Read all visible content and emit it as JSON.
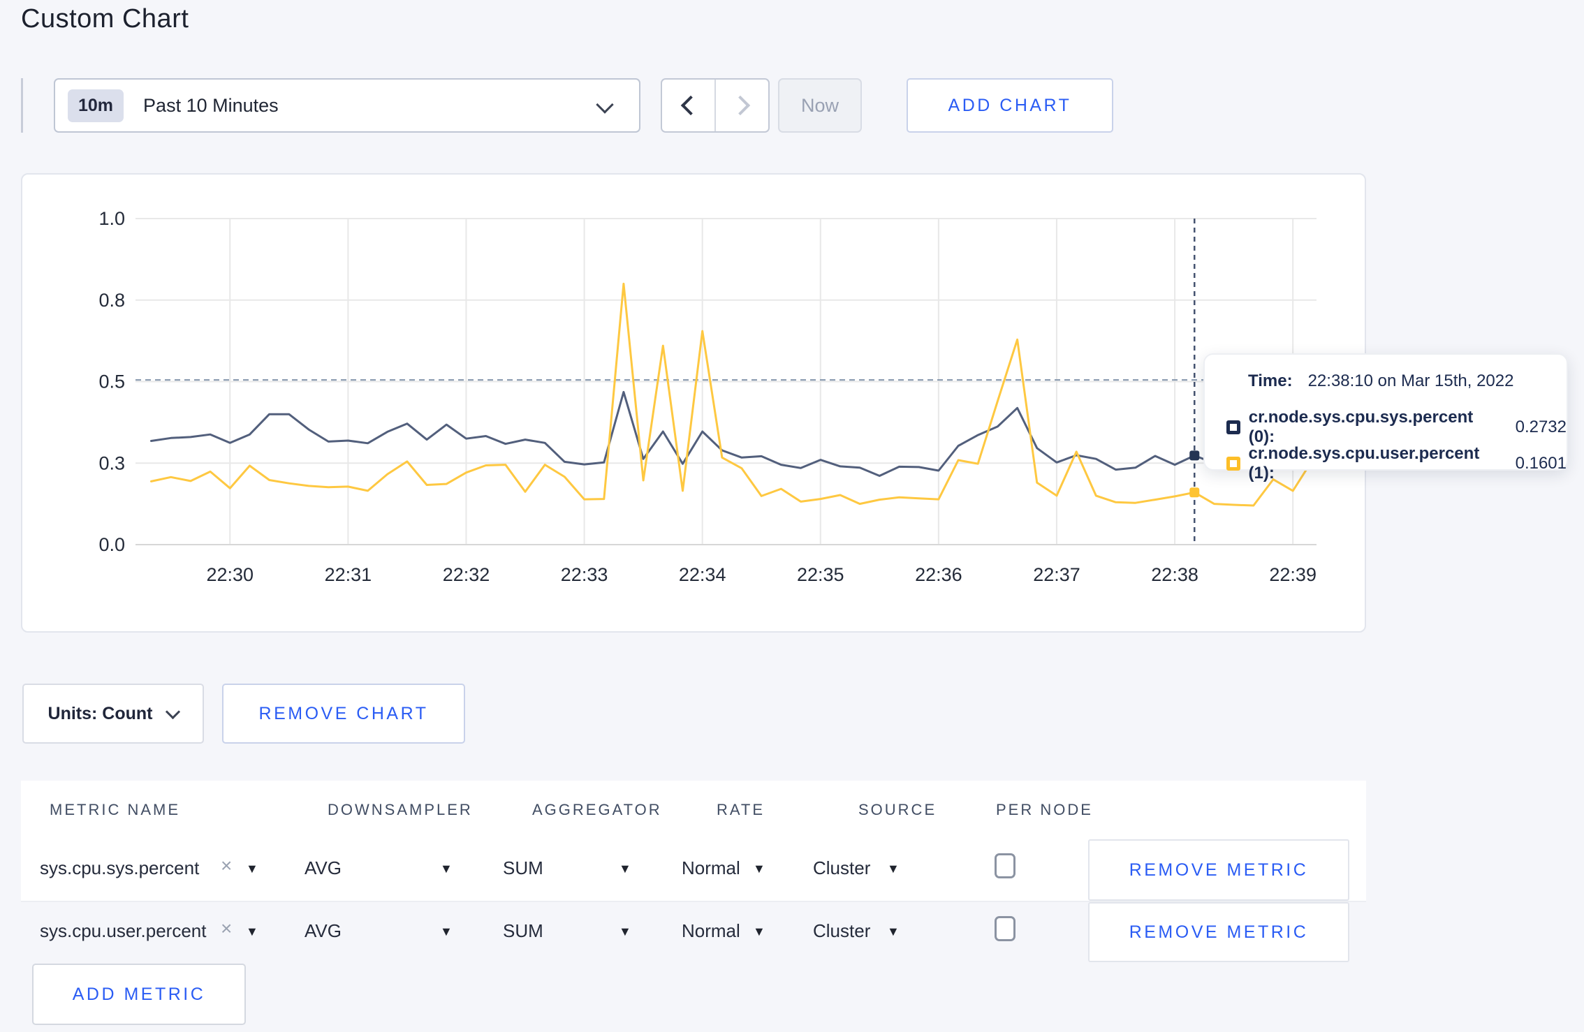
{
  "page": {
    "title": "Custom Chart"
  },
  "toolbar": {
    "time_range": {
      "badge": "10m",
      "label": "Past 10 Minutes"
    },
    "now_label": "Now",
    "add_chart_label": "ADD CHART"
  },
  "chart_controls": {
    "units_label": "Units: Count",
    "remove_chart_label": "REMOVE CHART"
  },
  "tooltip": {
    "time_label": "Time:",
    "time_value": "22:38:10 on Mar 15th, 2022",
    "series": [
      {
        "name": "cr.node.sys.cpu.sys.percent (0):",
        "value": "0.2732",
        "color": "#1c2b4f"
      },
      {
        "name": "cr.node.sys.cpu.user.percent (1):",
        "value": "0.1601",
        "color": "#fdbe27"
      }
    ]
  },
  "metrics_table": {
    "headers": [
      "METRIC NAME",
      "DOWNSAMPLER",
      "AGGREGATOR",
      "RATE",
      "SOURCE",
      "PER NODE"
    ],
    "rows": [
      {
        "metric": "sys.cpu.sys.percent",
        "downsampler": "AVG",
        "aggregator": "SUM",
        "rate": "Normal",
        "source": "Cluster",
        "per_node_checked": false,
        "remove_label": "REMOVE METRIC"
      },
      {
        "metric": "sys.cpu.user.percent",
        "downsampler": "AVG",
        "aggregator": "SUM",
        "rate": "Normal",
        "source": "Cluster",
        "per_node_checked": false,
        "remove_label": "REMOVE METRIC"
      }
    ],
    "add_metric_label": "ADD METRIC"
  },
  "ui": {
    "caret_glyph": "▼",
    "clear_glyph": "×"
  },
  "chart_data": {
    "type": "line",
    "title": "",
    "xlabel": "",
    "ylabel": "",
    "ylim": [
      0,
      1
    ],
    "grid": true,
    "legend_position": "tooltip",
    "y_ticks": [
      {
        "value": 0,
        "label": "0.0"
      },
      {
        "value": 0.25,
        "label": "0.3"
      },
      {
        "value": 0.5,
        "label": "0.5"
      },
      {
        "value": 0.75,
        "label": "0.8"
      },
      {
        "value": 1,
        "label": "1.0"
      }
    ],
    "x_ticks": [
      {
        "offset": 0,
        "label": "22:30"
      },
      {
        "offset": 60,
        "label": "22:31"
      },
      {
        "offset": 120,
        "label": "22:32"
      },
      {
        "offset": 180,
        "label": "22:33"
      },
      {
        "offset": 240,
        "label": "22:34"
      },
      {
        "offset": 300,
        "label": "22:35"
      },
      {
        "offset": 360,
        "label": "22:36"
      },
      {
        "offset": 420,
        "label": "22:37"
      },
      {
        "offset": 480,
        "label": "22:38"
      },
      {
        "offset": 540,
        "label": "22:39"
      }
    ],
    "x_domain_offsets": [
      -48,
      552
    ],
    "points_start_offset": -40,
    "point_interval_seconds": 10,
    "threshold_value": 0.505,
    "crosshair_offset": 490,
    "crosshair_time": "22:38:10",
    "series": [
      {
        "name": "cr.node.sys.cpu.sys.percent",
        "line_color": "#525f7c",
        "marker_color": "#253655",
        "values": [
          0.318,
          0.327,
          0.33,
          0.338,
          0.312,
          0.338,
          0.4,
          0.4,
          0.353,
          0.316,
          0.319,
          0.311,
          0.346,
          0.371,
          0.322,
          0.368,
          0.325,
          0.333,
          0.309,
          0.322,
          0.312,
          0.254,
          0.246,
          0.252,
          0.468,
          0.263,
          0.347,
          0.248,
          0.347,
          0.289,
          0.267,
          0.271,
          0.245,
          0.235,
          0.26,
          0.24,
          0.236,
          0.211,
          0.239,
          0.238,
          0.227,
          0.303,
          0.336,
          0.362,
          0.419,
          0.296,
          0.252,
          0.274,
          0.263,
          0.23,
          0.236,
          0.272,
          0.245,
          0.2732,
          0.25,
          0.248,
          0.25,
          0.255,
          0.27,
          0.3
        ]
      },
      {
        "name": "cr.node.sys.cpu.user.percent",
        "line_color": "#fec841",
        "marker_color": "#fdc332",
        "values": [
          0.194,
          0.207,
          0.195,
          0.224,
          0.173,
          0.242,
          0.198,
          0.188,
          0.18,
          0.176,
          0.178,
          0.165,
          0.216,
          0.255,
          0.183,
          0.186,
          0.221,
          0.243,
          0.245,
          0.162,
          0.245,
          0.208,
          0.139,
          0.14,
          0.8,
          0.197,
          0.61,
          0.165,
          0.655,
          0.267,
          0.234,
          0.149,
          0.171,
          0.132,
          0.14,
          0.152,
          0.125,
          0.138,
          0.145,
          0.142,
          0.139,
          0.259,
          0.248,
          0.44,
          0.629,
          0.19,
          0.15,
          0.285,
          0.15,
          0.13,
          0.128,
          0.138,
          0.148,
          0.1601,
          0.125,
          0.122,
          0.12,
          0.2,
          0.165,
          0.26
        ]
      }
    ],
    "colors": {
      "grid": "#e8e8e8",
      "axis": "#d7d7d7",
      "tick_text": "#242b39",
      "threshold": "#8496ac",
      "crosshair": "#44526f",
      "accent_blue": "#2a5cf4"
    }
  }
}
